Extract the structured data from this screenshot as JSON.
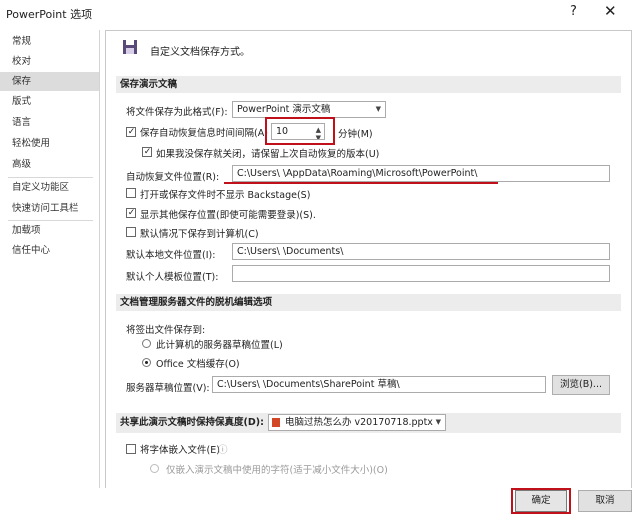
{
  "window": {
    "title": "PowerPoint 选项",
    "help": "?",
    "close": "✕"
  },
  "sidebar": {
    "items": [
      {
        "label": "常规"
      },
      {
        "label": "校对"
      },
      {
        "label": "保存"
      },
      {
        "label": "版式"
      },
      {
        "label": "语言"
      },
      {
        "label": "轻松使用"
      },
      {
        "label": "高级"
      },
      {
        "label": "自定义功能区"
      },
      {
        "label": "快速访问工具栏"
      },
      {
        "label": "加载项"
      },
      {
        "label": "信任中心"
      }
    ],
    "active_index": 2
  },
  "header": {
    "title": "自定义文档保存方式。"
  },
  "save_section": {
    "title": "保存演示文稿",
    "format_label": "将文件保存为此格式(F):",
    "format_value": "PowerPoint 演示文稿",
    "autorecover_label": "保存自动恢复信息时间间隔(A)",
    "autorecover_value": "10",
    "minutes_label": "分钟(M)",
    "keep_last_label": "如果我没保存就关闭，请保留上次自动恢复的版本(U)",
    "autorecover_location_label": "自动恢复文件位置(R):",
    "autorecover_location_value": "C:\\Users\\        \\AppData\\Roaming\\Microsoft\\PowerPoint\\",
    "dont_show_backstage_label": "打开或保存文件时不显示 Backstage(S)",
    "show_additional_label": "显示其他保存位置(即使可能需要登录)(S).",
    "save_to_computer_label": "默认情况下保存到计算机(C)",
    "default_local_label": "默认本地文件位置(I):",
    "default_local_value": "C:\\Users\\        \\Documents\\",
    "personal_templates_label": "默认个人模板位置(T):",
    "personal_templates_value": ""
  },
  "offline_section": {
    "title": "文档管理服务器文件的脱机编辑选项",
    "save_checkout_label": "将签出文件保存到:",
    "radio_server_drafts": "此计算机的服务器草稿位置(L)",
    "radio_office_cache": "Office 文档缓存(O)",
    "server_drafts_label": "服务器草稿位置(V):",
    "server_drafts_value": "C:\\Users\\        \\Documents\\SharePoint 草稿\\",
    "browse_label": "浏览(B)..."
  },
  "fidelity_section": {
    "title": "共享此演示文稿时保持保真度(D):",
    "file_value": "电脑过热怎么办 v20170718.pptx",
    "embed_fonts_label": "将字体嵌入文件(E)",
    "embed_option_1": "仅嵌入演示文稿中使用的字符(适于减小文件大小)(O)"
  },
  "footer": {
    "ok_label": "确定",
    "cancel_label": "取消"
  },
  "colors": {
    "accent_red": "#c0101a",
    "section_bg": "#ececec",
    "active_sidebar": "#dcdcdc"
  }
}
